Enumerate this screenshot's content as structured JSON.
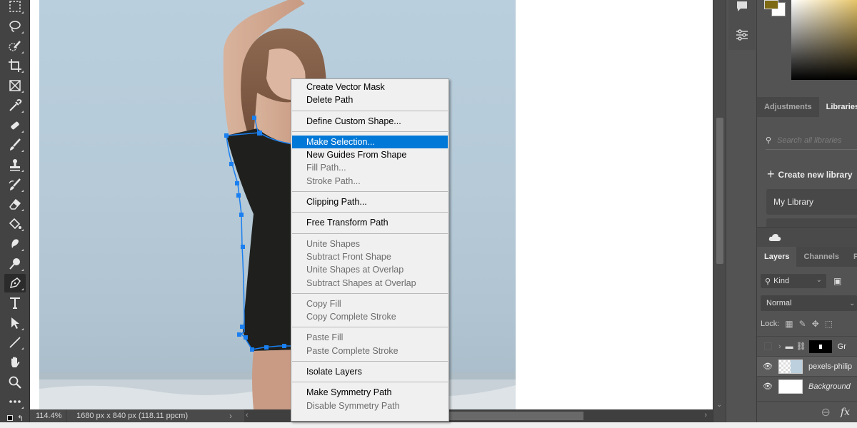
{
  "toolbar": {
    "tools": [
      {
        "name": "rectangular-marquee",
        "active": false
      },
      {
        "name": "lasso",
        "active": false
      },
      {
        "name": "object-selection",
        "active": false
      },
      {
        "name": "crop",
        "active": false
      },
      {
        "name": "frame",
        "active": false
      },
      {
        "name": "eyedropper",
        "active": false
      },
      {
        "name": "healing-brush",
        "active": false
      },
      {
        "name": "brush",
        "active": false
      },
      {
        "name": "clone-stamp",
        "active": false
      },
      {
        "name": "history-brush",
        "active": false
      },
      {
        "name": "eraser",
        "active": false
      },
      {
        "name": "paint-bucket",
        "active": false
      },
      {
        "name": "smudge",
        "active": false
      },
      {
        "name": "dodge",
        "active": false
      },
      {
        "name": "pen",
        "active": true
      },
      {
        "name": "type",
        "active": false
      },
      {
        "name": "path-selection",
        "active": false
      },
      {
        "name": "line",
        "active": false
      },
      {
        "name": "hand",
        "active": false
      },
      {
        "name": "zoom",
        "active": false
      },
      {
        "name": "more-tools",
        "active": false
      }
    ]
  },
  "statusbar": {
    "zoom": "114.4%",
    "doc_info": "1680 px x 840 px (118.11 ppcm)",
    "arrow": "›",
    "scroll_left": "‹",
    "scroll_right": "›"
  },
  "context_menu": {
    "groups": [
      [
        {
          "label": "Create Vector Mask",
          "enabled": true
        },
        {
          "label": "Delete Path",
          "enabled": true
        }
      ],
      [
        {
          "label": "Define Custom Shape...",
          "enabled": true
        }
      ],
      [
        {
          "label": "Make Selection...",
          "enabled": true,
          "highlighted": true
        },
        {
          "label": "New Guides From Shape",
          "enabled": true
        },
        {
          "label": "Fill Path...",
          "enabled": false
        },
        {
          "label": "Stroke Path...",
          "enabled": false
        }
      ],
      [
        {
          "label": "Clipping Path...",
          "enabled": true
        }
      ],
      [
        {
          "label": "Free Transform Path",
          "enabled": true
        }
      ],
      [
        {
          "label": "Unite Shapes",
          "enabled": false
        },
        {
          "label": "Subtract Front Shape",
          "enabled": false
        },
        {
          "label": "Unite Shapes at Overlap",
          "enabled": false
        },
        {
          "label": "Subtract Shapes at Overlap",
          "enabled": false
        }
      ],
      [
        {
          "label": "Copy Fill",
          "enabled": false
        },
        {
          "label": "Copy Complete Stroke",
          "enabled": false
        }
      ],
      [
        {
          "label": "Paste Fill",
          "enabled": false
        },
        {
          "label": "Paste Complete Stroke",
          "enabled": false
        }
      ],
      [
        {
          "label": "Isolate Layers",
          "enabled": true
        }
      ],
      [
        {
          "label": "Make Symmetry Path",
          "enabled": true
        },
        {
          "label": "Disable Symmetry Path",
          "enabled": false
        }
      ]
    ]
  },
  "colors": {
    "foreground": "#7e6a14",
    "background": "#ffffff",
    "menu_highlight": "#0078d7",
    "path_color": "#1a7ff0"
  },
  "libraries_panel": {
    "tabs": [
      {
        "label": "Adjustments",
        "active": false
      },
      {
        "label": "Libraries",
        "active": true
      }
    ],
    "search_placeholder": "Search all libraries",
    "create_label": "Create new library",
    "libraries": [
      "My Library"
    ]
  },
  "layers_panel": {
    "tabs": [
      {
        "label": "Layers",
        "active": true
      },
      {
        "label": "Channels",
        "active": false
      },
      {
        "label": "Pat",
        "active": false
      }
    ],
    "filter_kind": "Kind",
    "blend_mode": "Normal",
    "lock_label": "Lock:",
    "layers": [
      {
        "name": "Gr",
        "type": "group",
        "visible": false,
        "selected": false
      },
      {
        "name": "pexels-philip",
        "type": "smart-object",
        "visible": true,
        "selected": true
      },
      {
        "name": "Background",
        "type": "background",
        "visible": true,
        "selected": false
      }
    ],
    "footer": {
      "link": "⊖",
      "fx": "fx"
    }
  }
}
